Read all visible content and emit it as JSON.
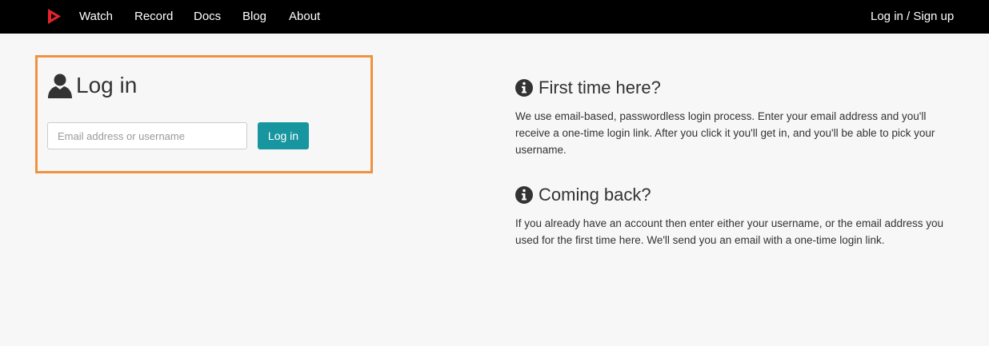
{
  "nav": {
    "logo_icon": "red-play-triangle-icon",
    "items": [
      {
        "label": "Watch"
      },
      {
        "label": "Record"
      },
      {
        "label": "Docs"
      },
      {
        "label": "Blog"
      },
      {
        "label": "About"
      }
    ],
    "auth_link": "Log in / Sign up"
  },
  "login": {
    "title": "Log in",
    "title_icon": "user-icon",
    "input_placeholder": "Email address or username",
    "input_value": "",
    "button_label": "Log in"
  },
  "info": {
    "first_time": {
      "icon": "info-icon",
      "heading": "First time here?",
      "body": "We use email-based, passwordless login process. Enter your email address and you'll receive a one-time login link. After you click it you'll get in, and you'll be able to pick your username."
    },
    "coming_back": {
      "icon": "info-icon",
      "heading": "Coming back?",
      "body": "If you already have an account then enter either your username, or the email address you used for the first time here. We'll send you an email with a one-time login link."
    }
  },
  "colors": {
    "navbar": "#000000",
    "accent_button": "#1796a0",
    "highlight_border": "#f0923f",
    "logo": "#e5232b",
    "background": "#f7f7f7"
  }
}
